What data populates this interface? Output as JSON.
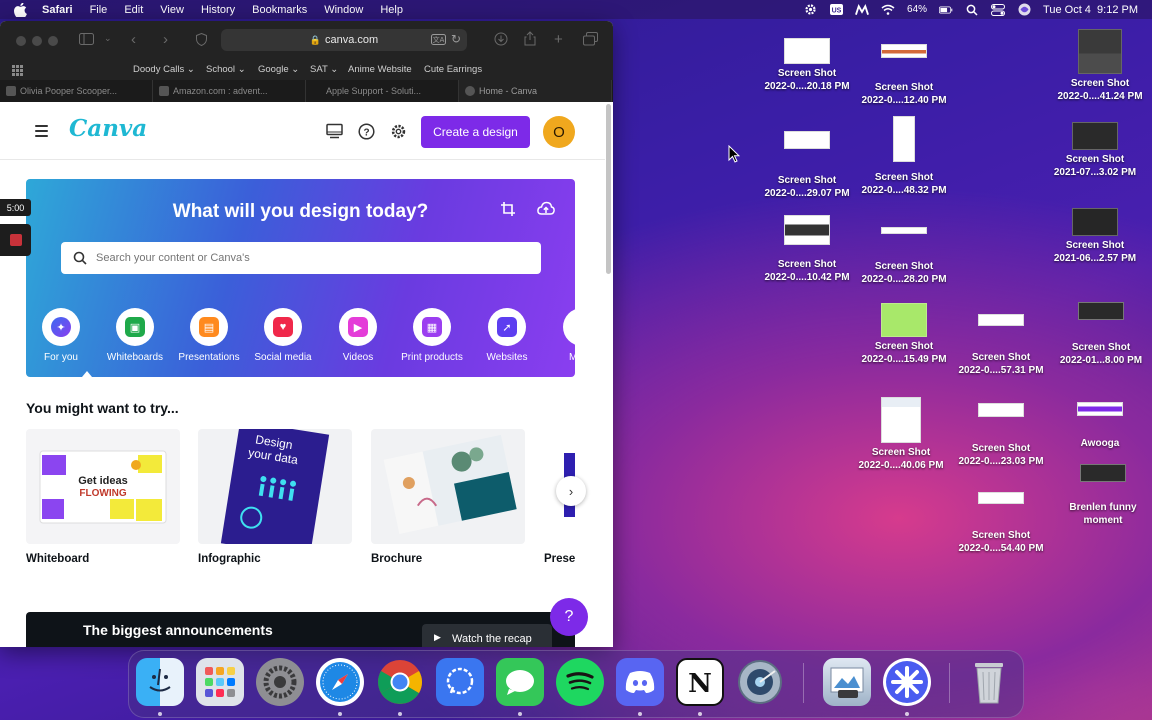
{
  "menubar": {
    "items": [
      "Safari",
      "File",
      "Edit",
      "View",
      "History",
      "Bookmarks",
      "Window",
      "Help"
    ],
    "battery": "64%",
    "datetime": "Tue Oct 4  9:12 PM"
  },
  "browser": {
    "url": "canva.com",
    "bookmarks": [
      "Doody Calls",
      "School",
      "Google",
      "SAT",
      "Anime Website",
      "Cute Earrings"
    ],
    "tabs": [
      "Olivia Pooper Scooper...",
      "Amazon.com : advent...",
      "Apple Support - Soluti...",
      "Home - Canva"
    ]
  },
  "canva": {
    "logo": "Canva",
    "create_label": "Create a design",
    "avatar_initial": "O",
    "hero_title": "What will you design today?",
    "search_placeholder": "Search your content or Canva's",
    "categories": [
      "For you",
      "Whiteboards",
      "Presentations",
      "Social media",
      "Videos",
      "Print products",
      "Websites",
      "M"
    ],
    "section_title": "You might want to try...",
    "cards": [
      "Whiteboard",
      "Infographic",
      "Brochure",
      "Prese"
    ],
    "whiteboard_thumb_text": [
      "Get ideas",
      "FLOWING"
    ],
    "infographic_thumb_text": [
      "Design",
      "your data"
    ],
    "announce": "The biggest announcements",
    "watch_label": "Watch the recap",
    "help": "?"
  },
  "recorder": {
    "time": "5:00"
  },
  "desktop": {
    "icons": [
      {
        "name": "Screen Shot",
        "sub": "2022-0....20.18 PM"
      },
      {
        "name": "Screen Shot",
        "sub": "2022-0....12.40 PM"
      },
      {
        "name": "Screen Shot",
        "sub": "2022-0....41.24 PM"
      },
      {
        "name": "Screen Shot",
        "sub": "2022-0....29.07 PM"
      },
      {
        "name": "Screen Shot",
        "sub": "2022-0....48.32 PM"
      },
      {
        "name": "Screen Shot",
        "sub": "2021-07...3.02 PM"
      },
      {
        "name": "Screen Shot",
        "sub": "2022-0....10.42 PM"
      },
      {
        "name": "Screen Shot",
        "sub": "2022-0....28.20 PM"
      },
      {
        "name": "Screen Shot",
        "sub": "2021-06...2.57 PM"
      },
      {
        "name": "Screen Shot",
        "sub": "2022-0....15.49 PM"
      },
      {
        "name": "Screen Shot",
        "sub": "2022-0....57.31 PM"
      },
      {
        "name": "Screen Shot",
        "sub": "2022-01...8.00 PM"
      },
      {
        "name": "Screen Shot",
        "sub": "2022-0....40.06 PM"
      },
      {
        "name": "Screen Shot",
        "sub": "2022-0....23.03 PM"
      },
      {
        "name": "Awooga",
        "sub": ""
      },
      {
        "name": "Screen Shot",
        "sub": "2022-0....54.40 PM"
      },
      {
        "name": "Brenlen funny",
        "sub": "moment"
      }
    ]
  },
  "dock": {
    "apps": [
      "finder-icon",
      "launchpad-icon",
      "system-preferences-icon",
      "safari-icon",
      "chrome-icon",
      "signal-icon",
      "messages-icon",
      "spotify-icon",
      "discord-icon",
      "notion-icon",
      "disk-utility-icon",
      "preview-icon",
      "perplexity-icon",
      "trash-icon"
    ]
  },
  "colors": {
    "canva_purple": "#7d2ae8",
    "canva_teal": "#1fb8d3",
    "avatar": "#f0a81e"
  }
}
